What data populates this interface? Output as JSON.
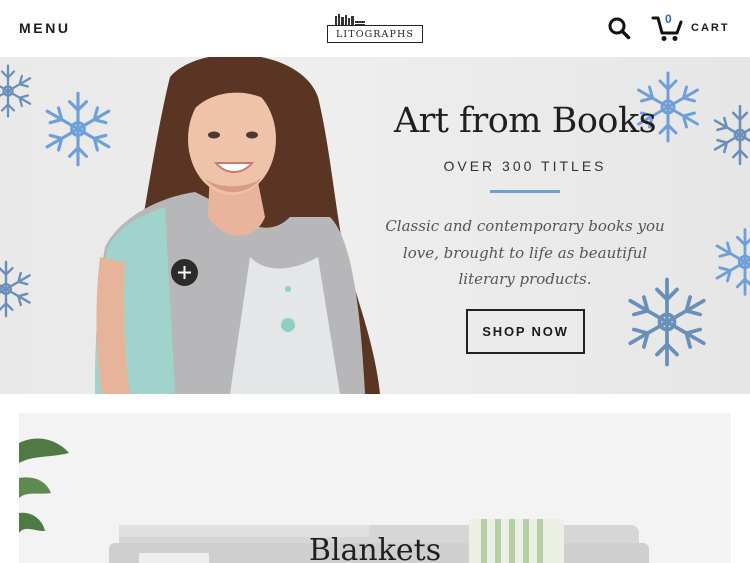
{
  "header": {
    "menu_label": "MENU",
    "logo_text": "LITOGRAPHS",
    "cart_count": "0",
    "cart_label": "CART"
  },
  "hero": {
    "title": "Art from Books",
    "subtitle": "OVER 300 TITLES",
    "body": "Classic and contemporary books you love, brought to life as beautiful literary products.",
    "button_label": "SHOP NOW",
    "accent_color": "#6f9fd9"
  },
  "category_card": {
    "title": "Blankets"
  },
  "icons": [
    "menu",
    "books-logo",
    "search-icon",
    "cart-icon",
    "plus-icon",
    "snowflake-icon"
  ]
}
